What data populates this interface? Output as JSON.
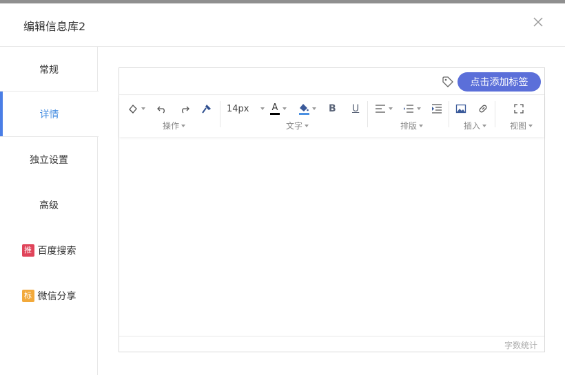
{
  "dialog": {
    "title": "编辑信息库2"
  },
  "sidebar": {
    "items": [
      {
        "label": "常规"
      },
      {
        "label": "详情"
      },
      {
        "label": "独立设置"
      },
      {
        "label": "高级"
      },
      {
        "label": "百度搜索",
        "badge": "推"
      },
      {
        "label": "微信分享",
        "badge": "标"
      }
    ],
    "active": "详情"
  },
  "editor": {
    "tag_button_label": "点击添加标签",
    "font_size_value": "14px",
    "groups": [
      {
        "label": "操作"
      },
      {
        "label": "文字"
      },
      {
        "label": "排版"
      },
      {
        "label": "插入"
      },
      {
        "label": "视图"
      }
    ],
    "bold_label": "B",
    "underline_label": "U",
    "font_color_letter": "A",
    "word_count_label": "字数统计"
  },
  "colors": {
    "accent": "#4a90e2",
    "tag_button": "#5b6fd9",
    "badge_recommend": "#e0445a",
    "badge_mark": "#f2a93b"
  }
}
